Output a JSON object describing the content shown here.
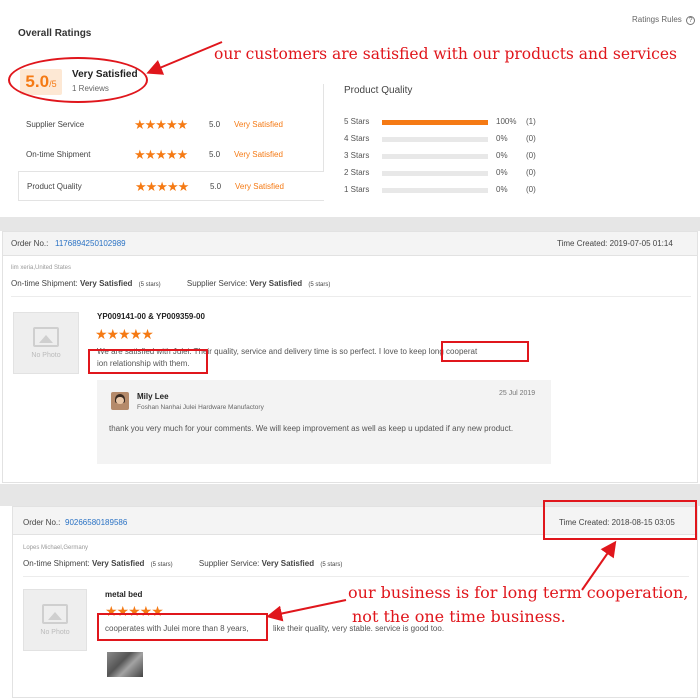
{
  "summary": {
    "title": "Overall Ratings",
    "rules_label": "Ratings Rules",
    "rules_icon": "question-circle-icon",
    "score": "5.0",
    "score_suffix": "/5",
    "score_text": "Very Satisfied",
    "reviews": "1 Reviews",
    "categories": [
      {
        "name": "Supplier Service",
        "stars": 5,
        "score": "5.0",
        "label": "Very Satisfied"
      },
      {
        "name": "On-time Shipment",
        "stars": 5,
        "score": "5.0",
        "label": "Very Satisfied"
      },
      {
        "name": "Product Quality",
        "stars": 5,
        "score": "5.0",
        "label": "Very Satisfied"
      }
    ],
    "quality_title": "Product Quality",
    "breakdown": [
      {
        "label": "5 Stars",
        "percent": 100,
        "pct_text": "100%",
        "count": "(1)"
      },
      {
        "label": "4 Stars",
        "percent": 0,
        "pct_text": "0%",
        "count": "(0)"
      },
      {
        "label": "3 Stars",
        "percent": 0,
        "pct_text": "0%",
        "count": "(0)"
      },
      {
        "label": "2 Stars",
        "percent": 0,
        "pct_text": "0%",
        "count": "(0)"
      },
      {
        "label": "1 Stars",
        "percent": 0,
        "pct_text": "0%",
        "count": "(0)"
      }
    ]
  },
  "orders": [
    {
      "order_label": "Order No.:",
      "order_no": "1176894250102989",
      "time_label": "Time Created:",
      "time": "2019-07-05 01:14",
      "buyer": "lim xeria,United States",
      "ontime_label": "On-time Shipment:",
      "ontime_value": "Very Satisfied",
      "ontime_stars": "(5 stars)",
      "supplier_label": "Supplier Service:",
      "supplier_value": "Very Satisfied",
      "supplier_stars": "(5 stars)",
      "photo_text": "No Photo",
      "product": "YP009141-00 & YP009359-00",
      "stars": 5,
      "review_a": "We are satisfied with Julei. Their quality, service and delivery time is so perfect. I love to keep long cooperat",
      "review_b": "ion relationship with them.",
      "reply": {
        "name": "Mily Lee",
        "company": "Foshan Nanhai Julei Hardware Manufactory",
        "date": "25 Jul 2019",
        "text": "thank you very much for your comments. We will keep improvement as well as keep u updated if any new product."
      }
    },
    {
      "order_label": "Order No.:",
      "order_no": "90266580189586",
      "time_label": "Time Created:",
      "time": "2018-08-15 03:05",
      "buyer": "Lopes Michael,Germany",
      "ontime_label": "On-time Shipment:",
      "ontime_value": "Very Satisfied",
      "ontime_stars": "(5 stars)",
      "supplier_label": "Supplier Service:",
      "supplier_value": "Very Satisfied",
      "supplier_stars": "(5 stars)",
      "photo_text": "No Photo",
      "product": "metal bed",
      "stars": 5,
      "review_a": "cooperates with Julei more than 8 years,",
      "review_b": "like their quality, very stable. service is good too."
    }
  ],
  "annotations": {
    "a1": "our customers are satisfied with our products and services",
    "a2_line1": "our business is for long term cooperation,",
    "a2_line2": "not the one time business."
  },
  "colors": {
    "accent": "#f57a14",
    "annotation": "#e0161c",
    "link": "#2a72c4"
  }
}
